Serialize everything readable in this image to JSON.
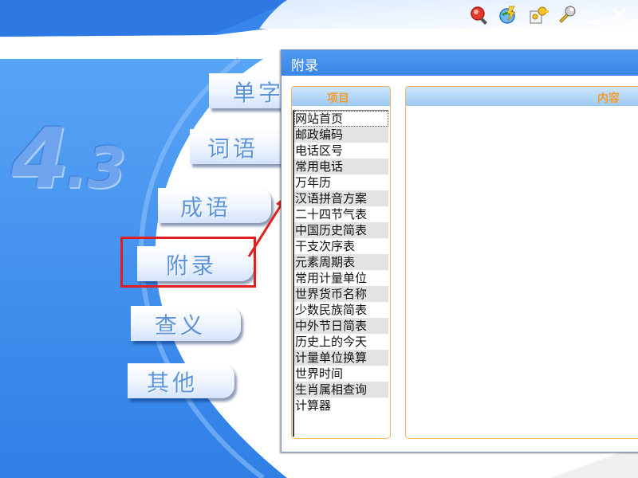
{
  "toolbar": {
    "icons": [
      "search-icon",
      "update-icon",
      "keys-icon",
      "wrench-icon",
      "minimize-icon",
      "close-icon"
    ]
  },
  "version": {
    "major": "4",
    "minor": ".3"
  },
  "nav": {
    "items": [
      {
        "id": "single-char",
        "label": "单字"
      },
      {
        "id": "words",
        "label": "词语"
      },
      {
        "id": "idioms",
        "label": "成语"
      },
      {
        "id": "appendix",
        "label": "附录"
      },
      {
        "id": "lookup",
        "label": "查义"
      },
      {
        "id": "others",
        "label": "其他"
      }
    ]
  },
  "dialog": {
    "title": "附录",
    "items_header": "项目",
    "content_header": "内容",
    "items": [
      "网站首页",
      "邮政编码",
      "电话区号",
      "常用电话",
      "万年历",
      "汉语拼音方案",
      "二十四节气表",
      "中国历史简表",
      "干支次序表",
      "元素周期表",
      "常用计量单位",
      "世界货币名称",
      "少数民族简表",
      "中外节日简表",
      "历史上的今天",
      "计量单位换算",
      "世界时间",
      "生肖属相查询",
      "计算器"
    ],
    "selected_index": 0
  },
  "colors": {
    "accent_blue": "#3d8cef",
    "panel_border": "#f3b560",
    "header_text": "#ef9e33",
    "highlight_red": "#e02020"
  }
}
